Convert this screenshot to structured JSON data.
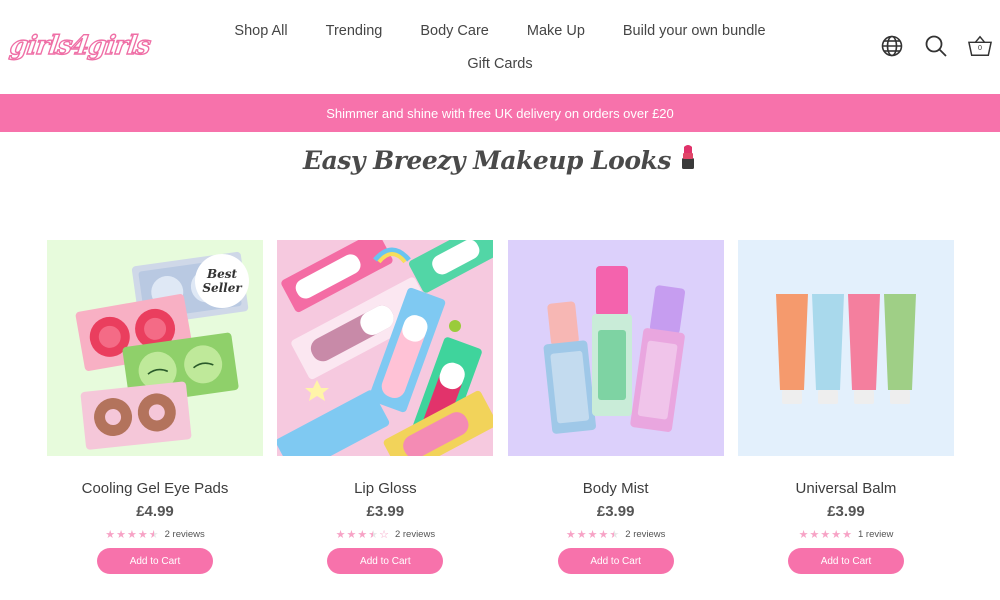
{
  "header": {
    "logo_text": "girls4girls",
    "nav_row1": [
      "Shop All",
      "Trending",
      "Body Care",
      "Make Up",
      "Build your own bundle"
    ],
    "nav_row2": [
      "Gift Cards"
    ],
    "icons": [
      "globe-icon",
      "search-icon",
      "cart-icon"
    ],
    "cart_count": "0"
  },
  "announcement": {
    "text": "Shimmer and shine with free UK delivery on orders over £20",
    "background": "#f772ab"
  },
  "section": {
    "title": "Easy Breezy Makeup Looks",
    "title_icon": "lipstick-emoji"
  },
  "colors": {
    "accent": "#f772ab",
    "star": "#f7a3c6"
  },
  "products": [
    {
      "name": "Cooling Gel Eye Pads",
      "price": "£4.99",
      "rating": 4.5,
      "reviews": "2 reviews",
      "button": "Add to Cart",
      "badge_line1": "Best",
      "badge_line2": "Seller",
      "bg": "#e7fbdc"
    },
    {
      "name": "Lip Gloss",
      "price": "£3.99",
      "rating": 3.5,
      "reviews": "2 reviews",
      "button": "Add to Cart",
      "bg": "#f6c9df"
    },
    {
      "name": "Body Mist",
      "price": "£3.99",
      "rating": 4.5,
      "reviews": "2 reviews",
      "button": "Add to Cart",
      "bg": "#dcd0fb"
    },
    {
      "name": "Universal Balm",
      "price": "£3.99",
      "rating": 5,
      "reviews": "1 review",
      "button": "Add to Cart",
      "bg": "#e3f0fc"
    }
  ]
}
